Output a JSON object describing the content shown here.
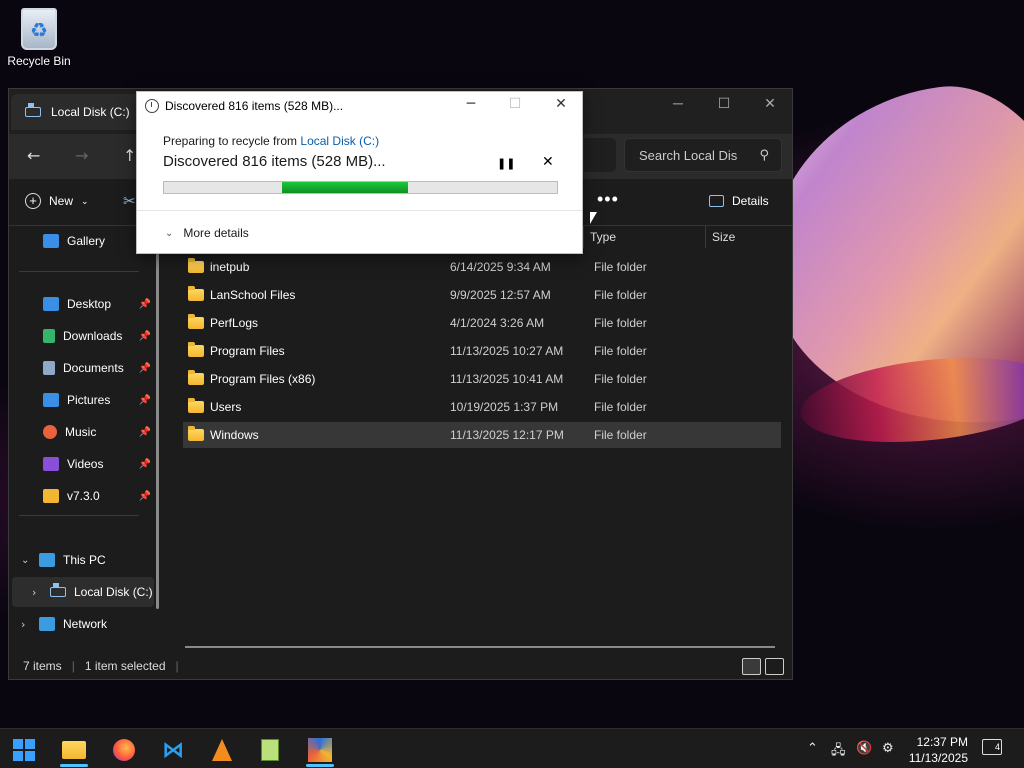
{
  "desktop": {
    "recycle_bin_label": "Recycle Bin"
  },
  "explorer": {
    "tab_title": "Local Disk (C:)",
    "search_placeholder": "Search Local Dis",
    "toolbar": {
      "new_label": "New",
      "details_label": "Details"
    },
    "sidebar": {
      "gallery": "Gallery",
      "quick": [
        {
          "label": "Desktop",
          "icon": "desktop-icon",
          "color": "#3a8ee6"
        },
        {
          "label": "Downloads",
          "icon": "download-icon",
          "color": "#35b56a"
        },
        {
          "label": "Documents",
          "icon": "document-icon",
          "color": "#8fa9c9"
        },
        {
          "label": "Pictures",
          "icon": "picture-icon",
          "color": "#3a8ee6"
        },
        {
          "label": "Music",
          "icon": "music-icon",
          "color": "#e8623b"
        },
        {
          "label": "Videos",
          "icon": "video-icon",
          "color": "#8a4fd8"
        },
        {
          "label": "v7.3.0",
          "icon": "folder-icon",
          "color": "#f2b632"
        }
      ],
      "this_pc": "This PC",
      "local_disk": "Local Disk (C:)",
      "network": "Network"
    },
    "columns": {
      "type": "Type",
      "size": "Size"
    },
    "rows": [
      {
        "name": "inetpub",
        "date": "6/14/2025 9:34 AM",
        "type": "File folder"
      },
      {
        "name": "LanSchool Files",
        "date": "9/9/2025 12:57 AM",
        "type": "File folder"
      },
      {
        "name": "PerfLogs",
        "date": "4/1/2024 3:26 AM",
        "type": "File folder"
      },
      {
        "name": "Program Files",
        "date": "11/13/2025 10:27 AM",
        "type": "File folder"
      },
      {
        "name": "Program Files (x86)",
        "date": "11/13/2025 10:41 AM",
        "type": "File folder"
      },
      {
        "name": "Users",
        "date": "10/19/2025 1:37 PM",
        "type": "File folder"
      },
      {
        "name": "Windows",
        "date": "11/13/2025 12:17 PM",
        "type": "File folder"
      }
    ],
    "status": {
      "items": "7 items",
      "selected": "1 item selected"
    }
  },
  "dialog": {
    "title": "Discovered 816 items (528 MB)...",
    "sub_prefix": "Preparing to recycle from",
    "sub_link": "Local Disk (C:)",
    "main": "Discovered 816 items (528 MB)...",
    "more_details": "More details",
    "progress_segment": {
      "start": 0.3,
      "end": 0.62
    }
  },
  "taskbar": {
    "time": "12:37 PM",
    "date": "11/13/2025",
    "notification_count": "4",
    "apps": [
      "start",
      "file-explorer",
      "firefox",
      "vscode",
      "vlc",
      "notepad-plus",
      "app"
    ]
  }
}
